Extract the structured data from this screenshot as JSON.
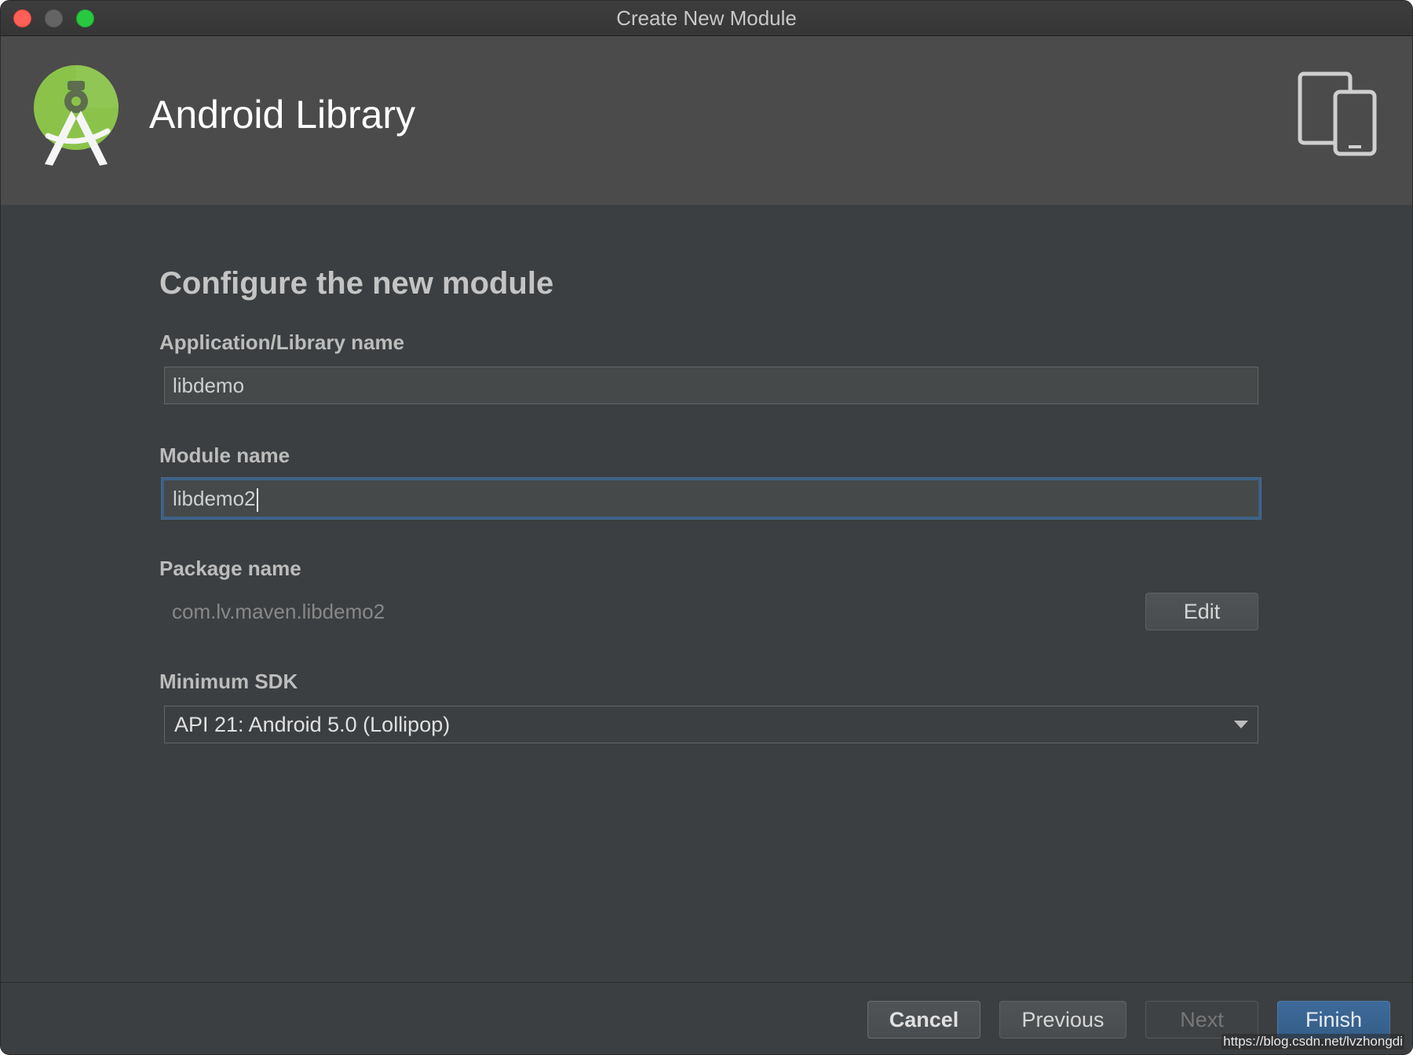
{
  "window": {
    "title": "Create New Module"
  },
  "header": {
    "title": "Android Library",
    "logo_icon": "android-studio-logo-icon",
    "device_icon": "tablet-phone-icon"
  },
  "form": {
    "heading": "Configure the new module",
    "app_name": {
      "label": "Application/Library name",
      "value": "libdemo"
    },
    "module_name": {
      "label": "Module name",
      "value": "libdemo2"
    },
    "package_name": {
      "label": "Package name",
      "value": "com.lv.maven.libdemo2",
      "edit_label": "Edit"
    },
    "min_sdk": {
      "label": "Minimum SDK",
      "selected": "API 21: Android 5.0 (Lollipop)"
    }
  },
  "footer": {
    "cancel_label": "Cancel",
    "previous_label": "Previous",
    "next_label": "Next",
    "finish_label": "Finish"
  },
  "watermark": "https://blog.csdn.net/lvzhongdi",
  "colors": {
    "background": "#3c3f41",
    "header_bg": "#4b4b4b",
    "focus_border": "#3d6185",
    "primary_button": "#365e88",
    "logo_green": "#8bc34a"
  }
}
